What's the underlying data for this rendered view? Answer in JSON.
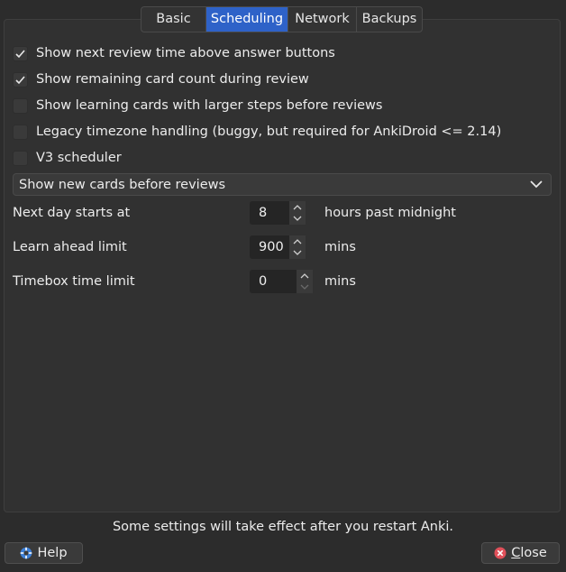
{
  "tabs": [
    {
      "label": "Basic",
      "active": false
    },
    {
      "label": "Scheduling",
      "active": true
    },
    {
      "label": "Network",
      "active": false
    },
    {
      "label": "Backups",
      "active": false
    }
  ],
  "checkboxes": [
    {
      "label": "Show next review time above answer buttons",
      "checked": true
    },
    {
      "label": "Show remaining card count during review",
      "checked": true
    },
    {
      "label": "Show learning cards with larger steps before reviews",
      "checked": false
    },
    {
      "label": "Legacy timezone handling (buggy, but required for AnkiDroid <= 2.14)",
      "checked": false
    },
    {
      "label": "V3 scheduler",
      "checked": false
    }
  ],
  "new_cards_order": {
    "selected": "Show new cards before reviews",
    "icon": "chevron-down-icon"
  },
  "fields": [
    {
      "label": "Next day starts at",
      "value": "8",
      "unit": "hours past midnight"
    },
    {
      "label": "Learn ahead limit",
      "value": "900",
      "unit": "mins"
    },
    {
      "label": "Timebox time limit",
      "value": "0",
      "unit": "mins"
    }
  ],
  "footer": {
    "note": "Some settings will take effect after you restart Anki.",
    "help_label": "Help",
    "help_icon": "help-lifebuoy-icon",
    "close_label": "Close",
    "close_icon": "close-circle-icon"
  },
  "colors": {
    "accent": "#2e62c8",
    "background": "#2c2c2c",
    "close_icon": "#e0505a",
    "help_icon": "#3d7fd6"
  }
}
